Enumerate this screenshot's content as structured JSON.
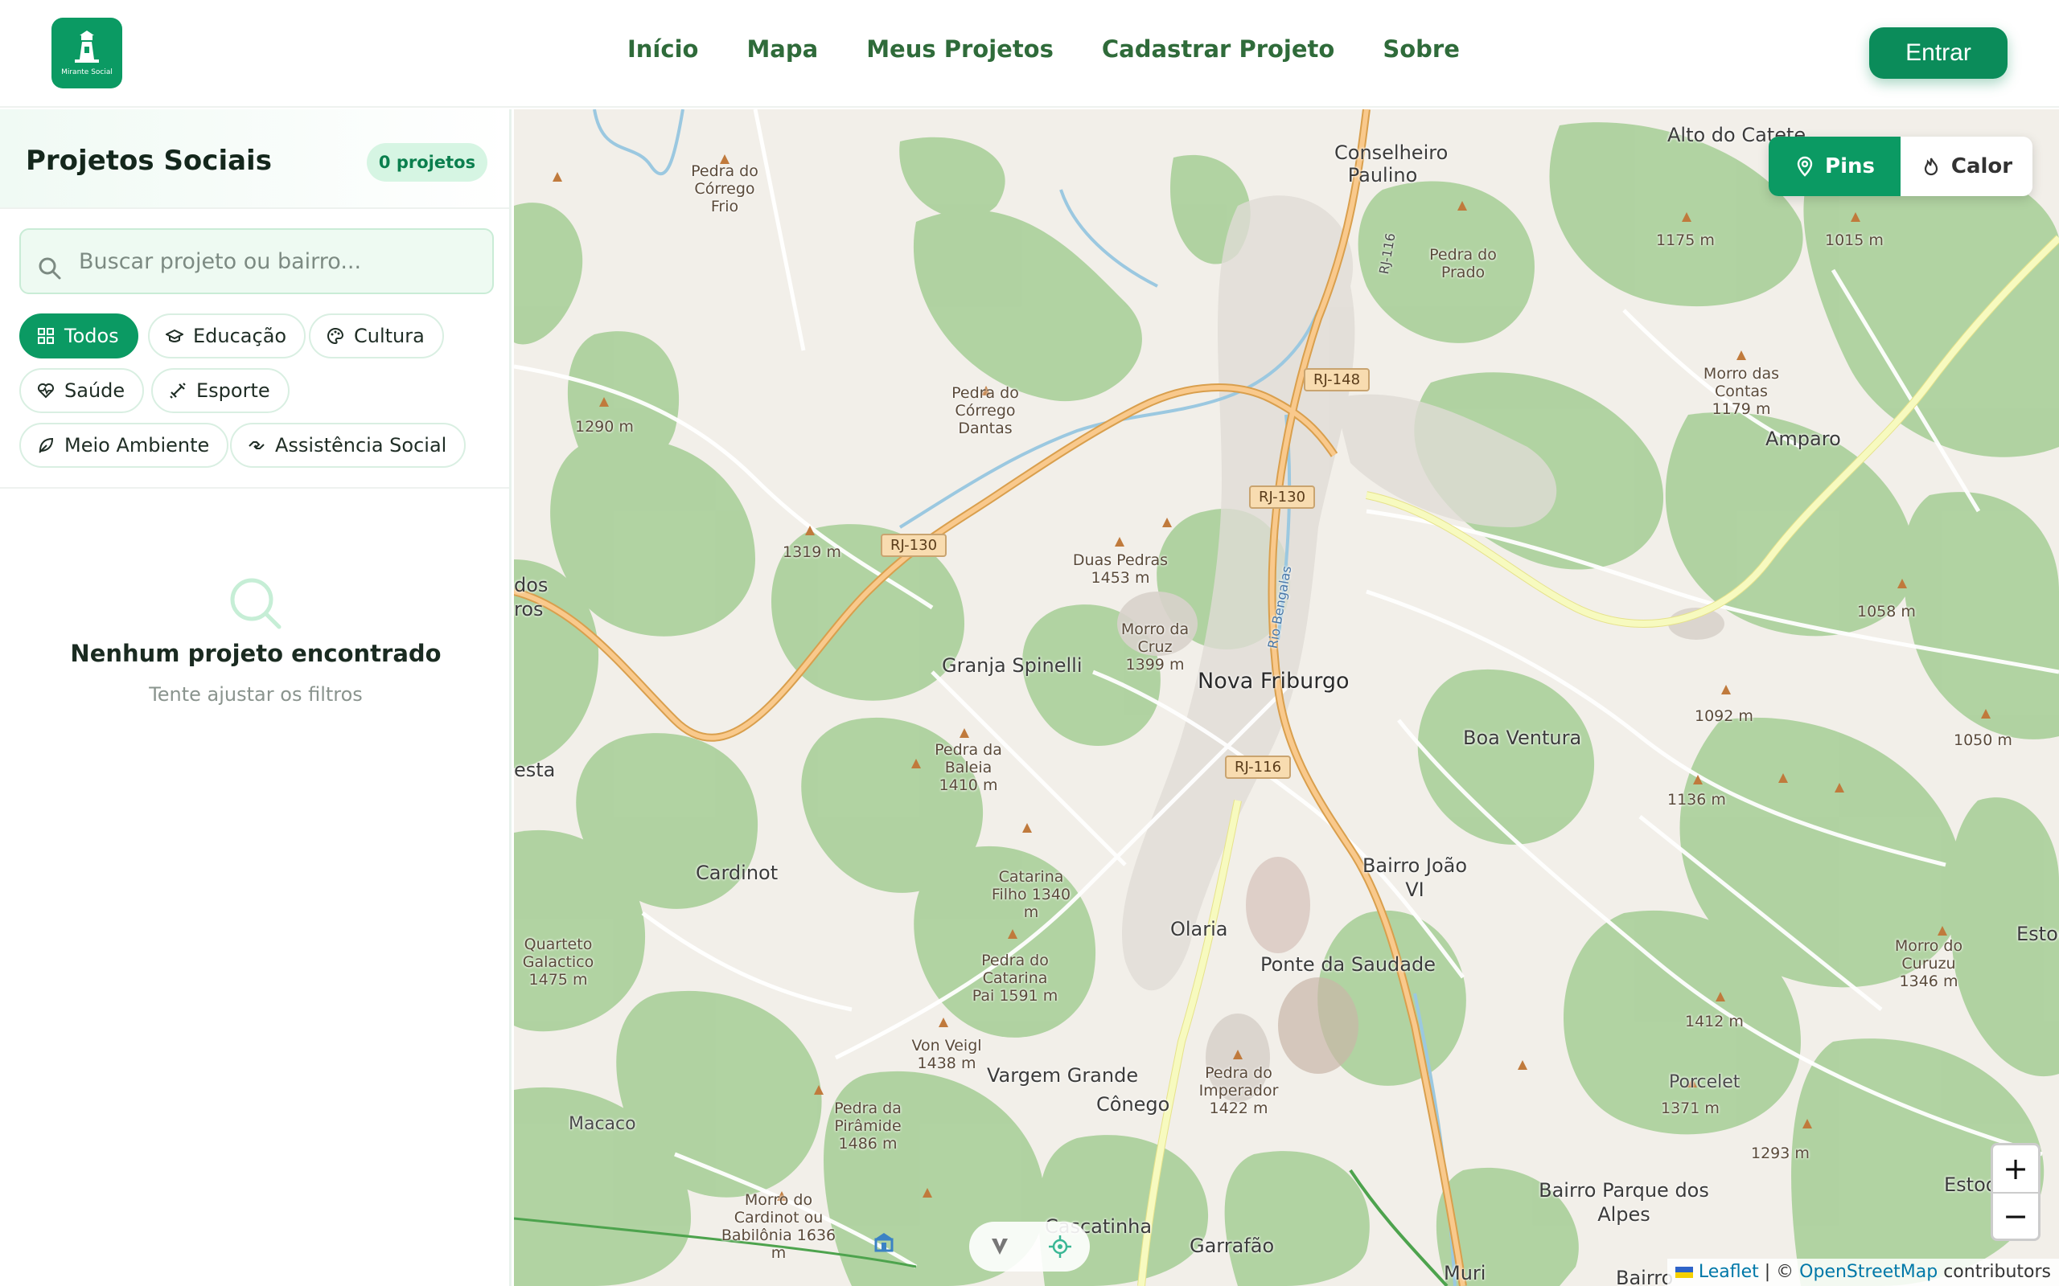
{
  "header": {
    "logo_text": "Mirante Social",
    "nav": [
      "Início",
      "Mapa",
      "Meus Projetos",
      "Cadastrar Projeto",
      "Sobre"
    ],
    "login_label": "Entrar"
  },
  "sidebar": {
    "title": "Projetos Sociais",
    "count_badge": "0 projetos",
    "search_placeholder": "Buscar projeto ou bairro...",
    "filters": [
      {
        "label": "Todos",
        "icon": "grid-icon",
        "active": true
      },
      {
        "label": "Educação",
        "icon": "graduation-cap-icon",
        "active": false
      },
      {
        "label": "Cultura",
        "icon": "palette-icon",
        "active": false
      },
      {
        "label": "Saúde",
        "icon": "heart-pulse-icon",
        "active": false
      },
      {
        "label": "Esporte",
        "icon": "dumbbell-icon",
        "active": false
      },
      {
        "label": "Meio Ambiente",
        "icon": "leaf-icon",
        "active": false
      },
      {
        "label": "Assistência Social",
        "icon": "handshake-icon",
        "active": false
      }
    ],
    "empty_title": "Nenhum projeto encontrado",
    "empty_subtitle": "Tente ajustar os filtros"
  },
  "map": {
    "layer_pins": "Pins",
    "layer_heat": "Calor",
    "zoom_in": "+",
    "zoom_out": "−",
    "attribution": {
      "leaflet": "Leaflet",
      "sep": "| ©",
      "osm": "OpenStreetMap",
      "suffix": "contributors"
    },
    "places": {
      "nova_friburgo": "Nova Friburgo",
      "granja_spinelli": "Granja Spinelli",
      "boa_ventura": "Boa Ventura",
      "conselheiro_paulino": "Conselheiro Paulino",
      "alto_do_catete": "Alto do Catete",
      "amparo": "Amparo",
      "cardinot": "Cardinot",
      "olaria": "Olaria",
      "ponte_da_saudade": "Ponte da Saudade",
      "bairro_joao_vi": "Bairro João VI",
      "vargem_grande": "Vargem Grande",
      "conego": "Cônego",
      "macaco": "Macaco",
      "porcelet": "Porcelet",
      "estoquim": "Estoquim",
      "bairro_parque_dos_alpes": "Bairro Parque dos Alpes",
      "garrafao": "Garrafão",
      "cascatinha": "Cascatinha",
      "muri": "Muri",
      "estoq": "Estoq",
      "esta": "esta",
      "dos": "dos",
      "ros": "ros",
      "bairro": "Bairro"
    },
    "peaks": {
      "p1": "Pedra do Córrego Frio",
      "p2": "Pedra do Prado",
      "p3": "1175 m",
      "p4": "1015 m",
      "p5": "1290 m",
      "p6": "Pedra do Córrego Dantas",
      "p7": "Morro das Contas 1179 m",
      "p8": "1319 m",
      "p9": "Duas Pedras 1453 m",
      "p10": "Morro da Cruz 1399 m",
      "p11": "1058 m",
      "p12": "1092 m",
      "p13": "1050 m",
      "p14": "Pedra da Baleia 1410 m",
      "p15": "1136 m",
      "p16": "Catarina Filho 1340 m",
      "p17": "Quarteto Galactico 1475 m",
      "p18": "Pedra do Catarina Pai 1591 m",
      "p19": "Morro do Curuzu 1346 m",
      "p20": "1412 m",
      "p21": "Von Veigl 1438 m",
      "p22": "Pedra do Imperador 1422 m",
      "p23": "Pedra da Pirâmide 1486 m",
      "p24": "1371 m",
      "p25": "1293 m",
      "p26": "Morro do Cardinot ou Babilônia 1636 m"
    },
    "roads": [
      "RJ-148",
      "RJ-130",
      "RJ-130",
      "RJ-116",
      "RJ-116",
      "Rio Bengalas"
    ]
  }
}
